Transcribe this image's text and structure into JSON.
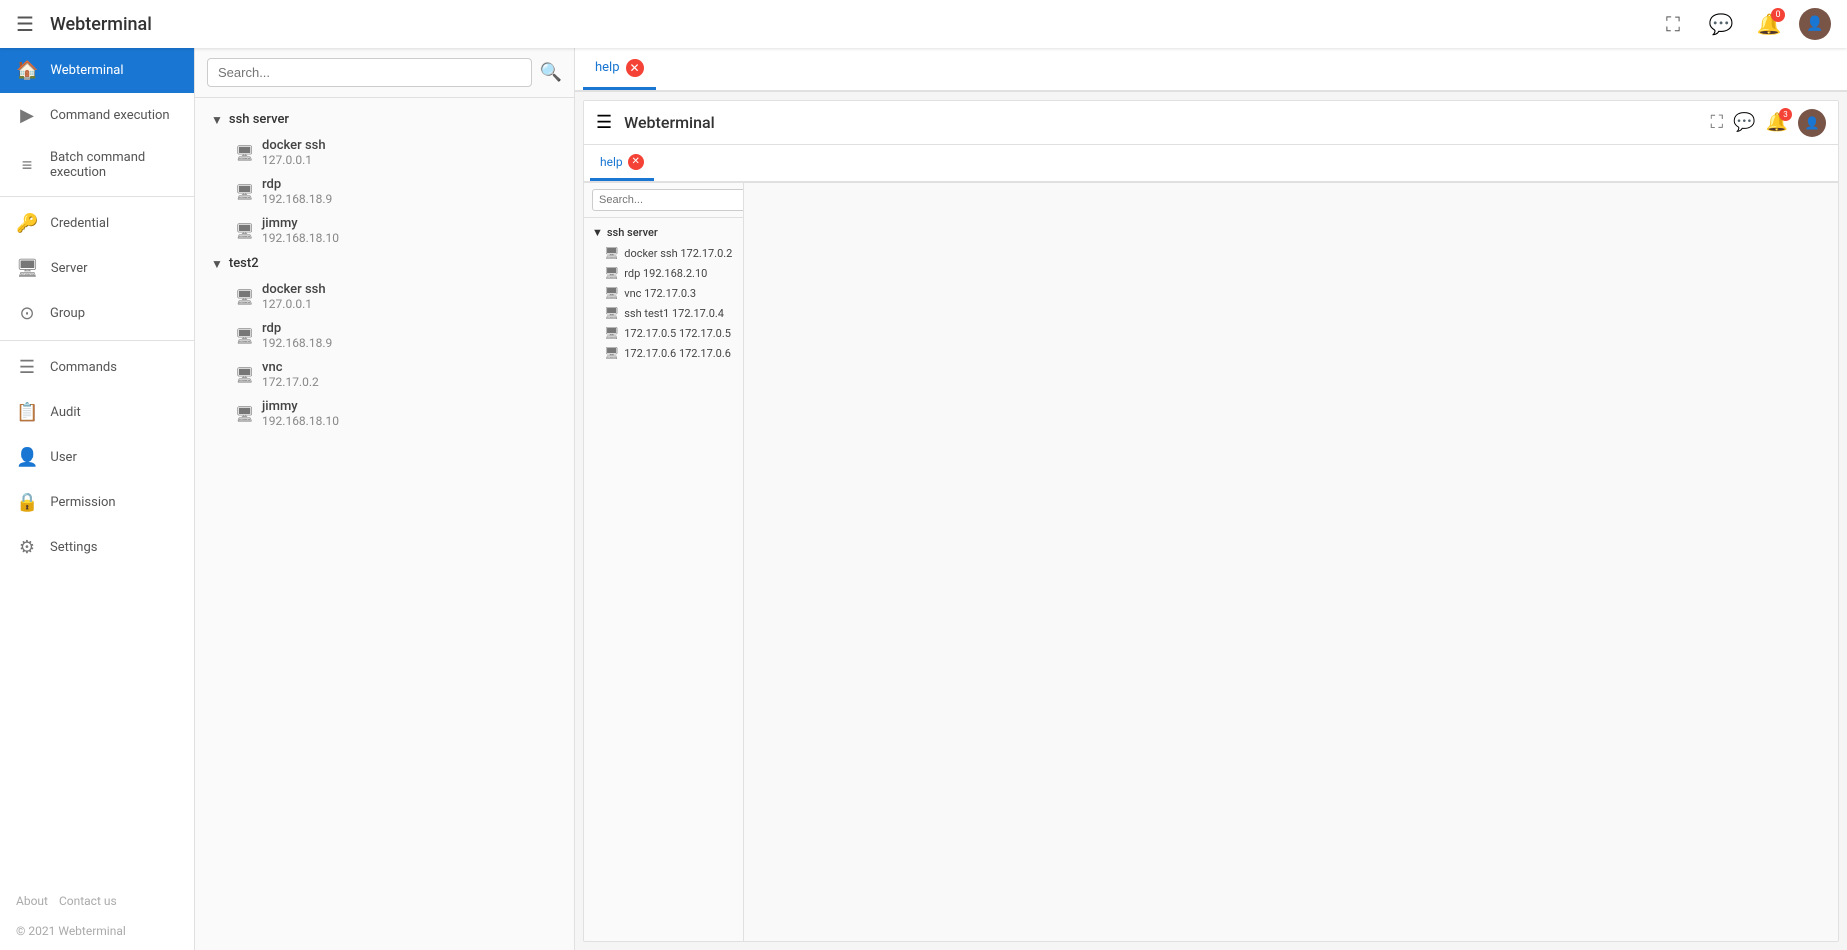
{
  "topbar": {
    "menu_icon": "☰",
    "title": "Webterminal",
    "fullscreen_icon": "⛶",
    "chat_icon": "💬",
    "notifications_icon": "🔔",
    "notifications_badge": "0",
    "avatar_letter": "👤"
  },
  "sidebar": {
    "home_label": "Webterminal",
    "items": [
      {
        "id": "command-execution",
        "label": "Command execution",
        "icon": "▶"
      },
      {
        "id": "batch-command-execution",
        "label": "Batch command execution",
        "icon": "≡"
      },
      {
        "id": "credential",
        "label": "Credential",
        "icon": "🔑"
      },
      {
        "id": "server",
        "label": "Server",
        "icon": "🖥"
      },
      {
        "id": "group",
        "label": "Group",
        "icon": "⊙"
      },
      {
        "id": "commands",
        "label": "Commands",
        "icon": "☰"
      },
      {
        "id": "audit",
        "label": "Audit",
        "icon": "📋"
      },
      {
        "id": "user",
        "label": "User",
        "icon": "👤"
      },
      {
        "id": "permission",
        "label": "Permission",
        "icon": "🔒"
      },
      {
        "id": "settings",
        "label": "Settings",
        "icon": "⚙"
      }
    ],
    "footer_links": [
      "About",
      "Contact us"
    ],
    "copyright": "© 2021 Webterminal"
  },
  "server_panel": {
    "search_placeholder": "Search...",
    "groups": [
      {
        "name": "ssh server",
        "expanded": true,
        "items": [
          {
            "type": "ssh",
            "name": "docker ssh",
            "ip": "127.0.0.1"
          },
          {
            "type": "rdp",
            "name": "rdp",
            "ip": "192.168.18.9"
          },
          {
            "type": "ssh",
            "name": "jimmy",
            "ip": "192.168.18.10"
          }
        ]
      },
      {
        "name": "test2",
        "expanded": true,
        "items": [
          {
            "type": "ssh",
            "name": "docker ssh",
            "ip": "127.0.0.1"
          },
          {
            "type": "rdp",
            "name": "rdp",
            "ip": "192.168.18.9"
          },
          {
            "type": "vnc",
            "name": "vnc",
            "ip": "172.17.0.2"
          },
          {
            "type": "ssh",
            "name": "jimmy",
            "ip": "192.168.18.10"
          }
        ]
      }
    ]
  },
  "tabs": [
    {
      "id": "help",
      "label": "help",
      "active": true,
      "closable": true
    }
  ],
  "inner_window": {
    "title": "Webterminal",
    "fullscreen_icon": "⛶",
    "chat_icon": "💬",
    "notifications_badge": "3",
    "avatar_letter": "👤",
    "tabs": [
      {
        "id": "help",
        "label": "help",
        "active": true,
        "closable": true
      }
    ],
    "server_panel": {
      "search_placeholder": "Search...",
      "groups": [
        {
          "name": "ssh server",
          "expanded": true,
          "items": [
            {
              "name": "docker ssh 172.17.0.2"
            },
            {
              "name": "rdp 192.168.2.10"
            },
            {
              "name": "vnc 172.17.0.3"
            },
            {
              "name": "ssh test1 172.17.0.4"
            },
            {
              "name": "172.17.0.5 172.17.0.5"
            },
            {
              "name": "172.17.0.6 172.17.0.6"
            }
          ]
        }
      ]
    }
  }
}
